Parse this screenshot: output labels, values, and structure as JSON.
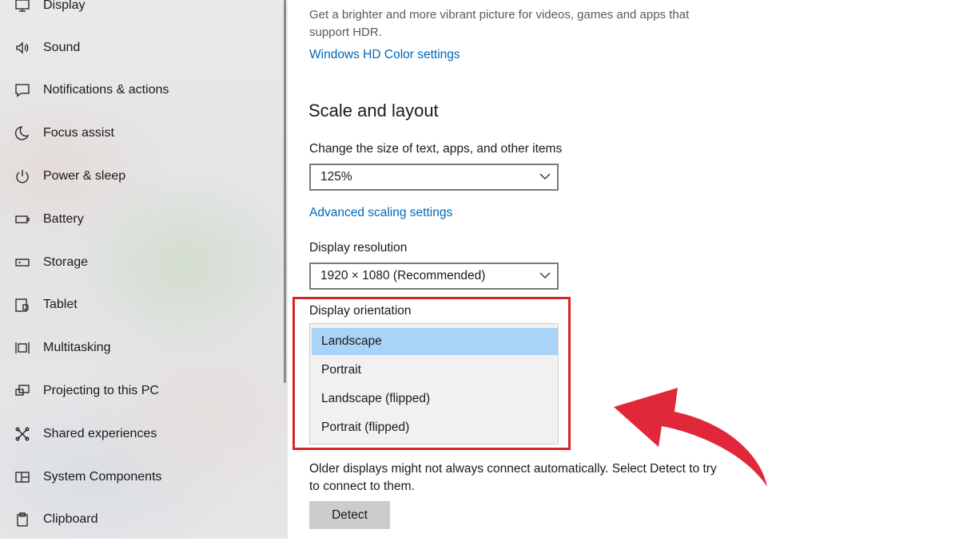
{
  "sidebar": {
    "items": [
      {
        "label": "Display",
        "icon": "monitor-icon"
      },
      {
        "label": "Sound",
        "icon": "speaker-icon"
      },
      {
        "label": "Notifications & actions",
        "icon": "notification-icon"
      },
      {
        "label": "Focus assist",
        "icon": "moon-icon"
      },
      {
        "label": "Power & sleep",
        "icon": "power-icon"
      },
      {
        "label": "Battery",
        "icon": "battery-icon"
      },
      {
        "label": "Storage",
        "icon": "storage-icon"
      },
      {
        "label": "Tablet",
        "icon": "tablet-icon"
      },
      {
        "label": "Multitasking",
        "icon": "multitasking-icon"
      },
      {
        "label": "Projecting to this PC",
        "icon": "projecting-icon"
      },
      {
        "label": "Shared experiences",
        "icon": "shared-icon"
      },
      {
        "label": "System Components",
        "icon": "components-icon"
      },
      {
        "label": "Clipboard",
        "icon": "clipboard-icon"
      }
    ]
  },
  "main": {
    "hdr_description": "Get a brighter and more vibrant picture for videos, games and apps that support HDR.",
    "hdr_link": "Windows HD Color settings",
    "scale_heading": "Scale and layout",
    "scale_label": "Change the size of text, apps, and other items",
    "scale_value": "125%",
    "advanced_scaling_link": "Advanced scaling settings",
    "resolution_label": "Display resolution",
    "resolution_value": "1920 × 1080 (Recommended)",
    "orientation_label": "Display orientation",
    "orientation_options": [
      "Landscape",
      "Portrait",
      "Landscape (flipped)",
      "Portrait (flipped)"
    ],
    "orientation_selected": "Landscape",
    "detect_note": "Older displays might not always connect automatically. Select Detect to try to connect to them.",
    "detect_button": "Detect"
  },
  "colors": {
    "accent_link": "#0067b8",
    "selected_option": "#a9d4f7",
    "highlight": "#d8232a",
    "arrow": "#e0283a"
  }
}
